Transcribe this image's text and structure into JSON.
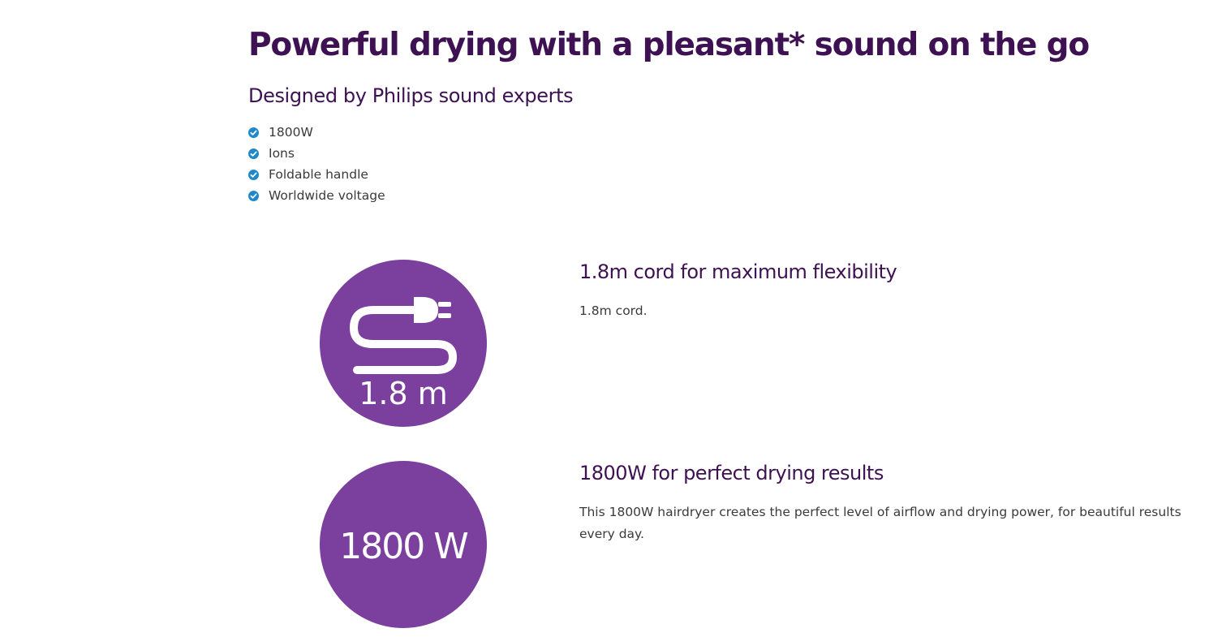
{
  "headline": "Powerful drying with a pleasant* sound on the go",
  "subheadline": "Designed by Philips sound experts",
  "features": [
    {
      "label": "1800W",
      "icon": "check-circle-icon"
    },
    {
      "label": "Ions",
      "icon": "check-circle-icon"
    },
    {
      "label": "Foldable handle",
      "icon": "check-circle-icon"
    },
    {
      "label": "Worldwide voltage",
      "icon": "check-circle-icon"
    }
  ],
  "benefits": [
    {
      "icon": "cord-plug-icon",
      "icon_text": "1.8 m",
      "title": "1.8m cord for maximum flexibility",
      "description": "1.8m cord."
    },
    {
      "icon": "power-wattage-icon",
      "icon_text": "1800 W",
      "title": "1800W for perfect drying results",
      "description": "This 1800W hairdryer creates the perfect level of airflow and drying power, for beautiful results every day."
    }
  ],
  "colors": {
    "heading": "#3d1152",
    "check_icon": "#1e88c9",
    "badge_circle": "#7b3f9e",
    "body_text": "#3a3a3a"
  }
}
